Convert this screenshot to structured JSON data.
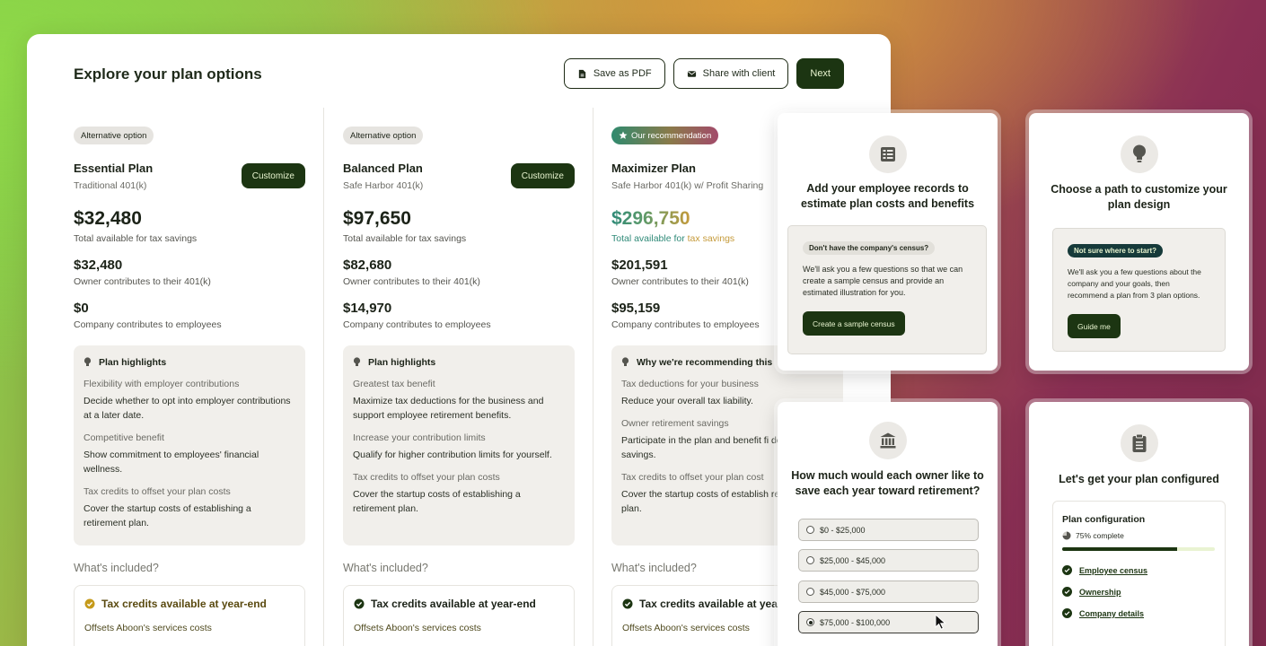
{
  "header": {
    "title": "Explore your plan options",
    "save_pdf": "Save as PDF",
    "share": "Share with client",
    "next": "Next"
  },
  "plans": [
    {
      "badge": "Alternative option",
      "name": "Essential Plan",
      "type": "Traditional 401(k)",
      "customize": "Customize",
      "total": "$32,480",
      "total_label": "Total available for tax savings",
      "owner_amount": "$32,480",
      "owner_label": "Owner contributes to their 401(k)",
      "company_amount": "$0",
      "company_label": "Company contributes to employees",
      "highlights_title": "Plan highlights",
      "highlights": [
        {
          "title": "Flexibility with employer contributions",
          "desc": "Decide whether to opt into employer contributions at a later date."
        },
        {
          "title": "Competitive benefit",
          "desc": "Show commitment to employees' financial wellness."
        },
        {
          "title": "Tax credits to offset your plan costs",
          "desc": "Cover the startup costs of establishing a retirement plan."
        }
      ],
      "included_title": "What's included?",
      "included_item": "Tax credits available at year-end",
      "included_desc": "Offsets Aboon's services costs"
    },
    {
      "badge": "Alternative option",
      "name": "Balanced Plan",
      "type": "Safe Harbor 401(k)",
      "customize": "Customize",
      "total": "$97,650",
      "total_label": "Total available for tax savings",
      "owner_amount": "$82,680",
      "owner_label": "Owner contributes to their 401(k)",
      "company_amount": "$14,970",
      "company_label": "Company contributes to employees",
      "highlights_title": "Plan highlights",
      "highlights": [
        {
          "title": "Greatest tax benefit",
          "desc": "Maximize tax deductions for the business and support employee retirement benefits."
        },
        {
          "title": "Increase your contribution limits",
          "desc": "Qualify for higher contribution limits for yourself."
        },
        {
          "title": "Tax credits to offset your plan costs",
          "desc": "Cover the startup costs of establishing a retirement plan."
        }
      ],
      "included_title": "What's included?",
      "included_item": "Tax credits available at year-end",
      "included_desc": "Offsets Aboon's services costs"
    },
    {
      "badge": "Our recommendation",
      "name": "Maximizer Plan",
      "type": "Safe Harbor 401(k) w/ Profit Sharing",
      "total": "$296,750",
      "total_label_a": "Total available for ",
      "total_label_b": "tax savings",
      "owner_amount": "$201,591",
      "owner_label": "Owner contributes to their 401(k)",
      "company_amount": "$95,159",
      "company_label": "Company contributes to employees",
      "highlights_title": "Why we're recommending this",
      "highlights": [
        {
          "title": "Tax deductions for your business",
          "desc": "Reduce your overall tax liability."
        },
        {
          "title": "Owner retirement savings",
          "desc": "Participate in the plan and benefit fi deferred savings."
        },
        {
          "title": "Tax credits to offset your plan cost",
          "desc": "Cover the startup costs of establish retirement plan."
        }
      ],
      "included_title": "What's included?",
      "included_item": "Tax credits available at yea",
      "included_desc": "Offsets Aboon's services costs"
    }
  ],
  "census_card": {
    "title": "Add your employee records to estimate plan costs and benefits",
    "pill": "Don't have the company's census?",
    "text": "We'll ask you a few questions so that we can create a sample census and provide an estimated illustration for you.",
    "button": "Create a sample census"
  },
  "path_card": {
    "title": "Choose a path to customize your plan design",
    "pill": "Not sure where to start?",
    "text": "We'll ask you a few questions about the company and your goals, then recommend a plan from 3 plan options.",
    "button": "Guide me"
  },
  "savings_card": {
    "title": "How much would each owner like to save each year toward retirement?",
    "options": [
      "$0 - $25,000",
      "$25,000 - $45,000",
      "$45,000 - $75,000",
      "$75,000 - $100,000"
    ],
    "selected": "$75,000 - $100,000"
  },
  "config_card": {
    "title": "Let's get your plan configured",
    "box_title": "Plan configuration",
    "progress_label": "75% complete",
    "progress": 0.75,
    "items": [
      "Employee census",
      "Ownership",
      "Company details"
    ]
  },
  "colors": {
    "brand_dark": "#1c3512",
    "brand_light_text": "#e8f4cf",
    "panel_bg": "#ffffff",
    "highlight_bg": "#f1efeb"
  }
}
